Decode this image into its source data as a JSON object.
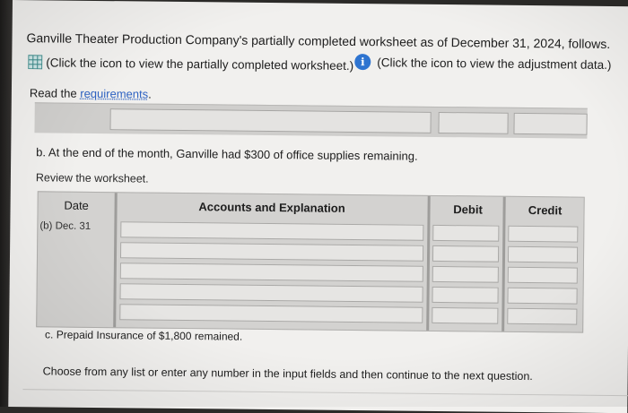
{
  "intro": {
    "title": "Ganville Theater Production Company's partially completed worksheet as of December 31, 2024, follows.",
    "worksheet_link": "(Click the icon to view the partially completed worksheet.)",
    "adjustment_link": "(Click the icon to view the adjustment data.)",
    "read_prefix": "Read the ",
    "requirements_link": "requirements",
    "read_suffix": "."
  },
  "part_b": {
    "label": "b. At the end of the month, Ganville had $300 of office supplies remaining.",
    "review": "Review the worksheet."
  },
  "journal": {
    "headers": {
      "date": "Date",
      "accounts": "Accounts and Explanation",
      "debit": "Debit",
      "credit": "Credit"
    },
    "entry_date": "(b) Dec. 31",
    "row_count": 5
  },
  "part_c": {
    "label": "c. Prepaid Insurance of $1,800 remained."
  },
  "footer": {
    "instruction": "Choose from any list or enter any number in the input fields and then continue to the next question."
  },
  "icons": {
    "worksheet": "spreadsheet-grid-icon",
    "info": "info-icon"
  },
  "colors": {
    "link": "#2f63c2",
    "info_icon": "#2e74d0",
    "grid_icon": "#3a8a8a"
  }
}
